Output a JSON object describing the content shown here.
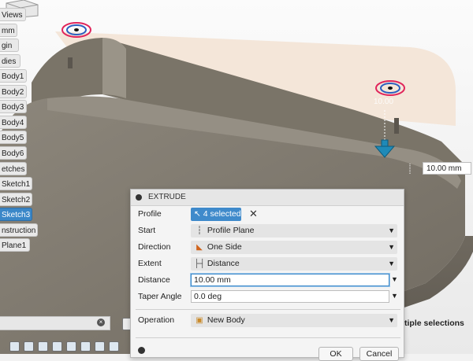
{
  "browser": {
    "items": [
      {
        "label": "Views",
        "selected": false
      },
      {
        "label": "mm",
        "selected": false
      },
      {
        "label": "gin",
        "selected": false
      },
      {
        "label": "dies",
        "selected": false
      },
      {
        "label": "Body1",
        "selected": false
      },
      {
        "label": "Body2",
        "selected": false
      },
      {
        "label": "Body3",
        "selected": false
      },
      {
        "label": "Body4",
        "selected": false
      },
      {
        "label": "Body5",
        "selected": false
      },
      {
        "label": "Body6",
        "selected": false
      },
      {
        "label": "etches",
        "selected": false
      },
      {
        "label": "Sketch1",
        "selected": false
      },
      {
        "label": "Sketch2",
        "selected": false
      },
      {
        "label": "Sketch3",
        "selected": true
      },
      {
        "label": "nstruction",
        "selected": false
      },
      {
        "label": "Plane1",
        "selected": false
      }
    ]
  },
  "canvas": {
    "dimension_value": "10.00 mm",
    "ghost_dimension": "10.00",
    "body_color": "#7f786d",
    "plane_color": "#f3e3d3",
    "handle_color": "#1f8ab8"
  },
  "dialog": {
    "title": "EXTRUDE",
    "profile": {
      "label": "Profile",
      "value": "4 selected",
      "clear_icon": "close-icon"
    },
    "start": {
      "label": "Start",
      "value": "Profile Plane",
      "icon": "profile-plane-icon"
    },
    "direction": {
      "label": "Direction",
      "value": "One Side",
      "icon": "one-side-icon"
    },
    "extent": {
      "label": "Extent",
      "value": "Distance",
      "icon": "distance-icon"
    },
    "distance": {
      "label": "Distance",
      "value": "10.00 mm"
    },
    "taper_angle": {
      "label": "Taper Angle",
      "value": "0.0 deg"
    },
    "operation": {
      "label": "Operation",
      "value": "New Body",
      "icon": "new-body-icon"
    },
    "ok_label": "OK",
    "cancel_label": "Cancel",
    "accent_color": "#3f8acb"
  },
  "status": {
    "multi_selection_text": "tiple selections"
  }
}
